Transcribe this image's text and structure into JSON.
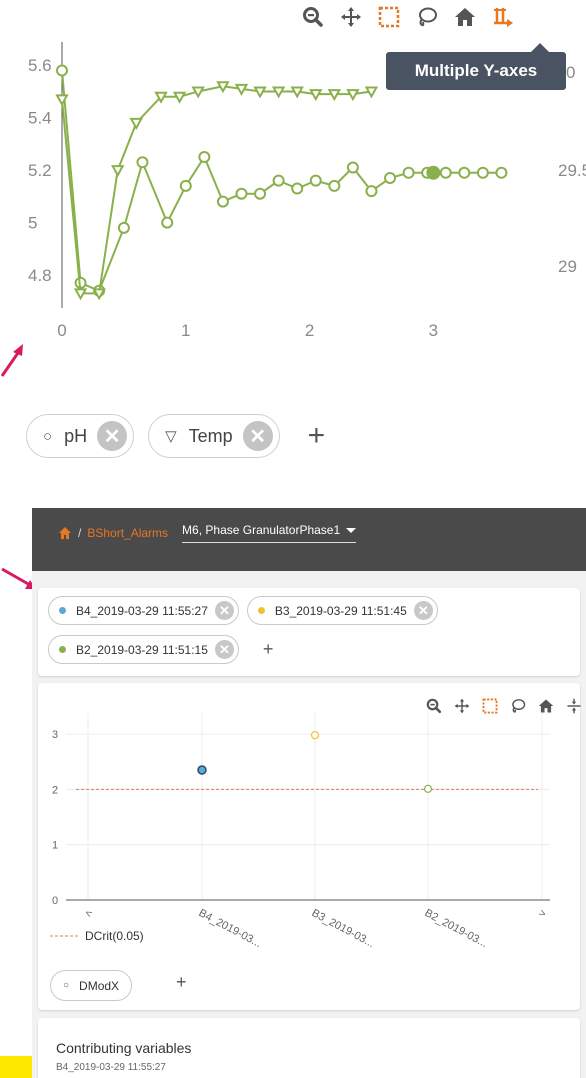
{
  "top_chart": {
    "toolbar_icons": [
      "zoom-icon",
      "pan-icon",
      "box-select-icon",
      "lasso-select-icon",
      "reset-axes-icon",
      "multiple-y-axes-icon"
    ],
    "tooltip": "Multiple Y-axes",
    "left_axis_ticks": [
      "5.6",
      "5.4",
      "5.2",
      "5",
      "4.8"
    ],
    "right_axis_ticks": [
      "0",
      "29.5",
      "29"
    ],
    "x_axis_ticks": [
      "0",
      "1",
      "2",
      "3"
    ],
    "colors": {
      "series": "#8ab04c",
      "tooltip_bg": "#4a5362",
      "active_icon": "#e87722",
      "icon": "#555555",
      "arrow": "#d81b60"
    }
  },
  "chart_data": [
    {
      "type": "line",
      "series": [
        {
          "name": "pH",
          "marker": "circle",
          "x": [
            0,
            0.15,
            0.3,
            0.5,
            0.65,
            0.85,
            1.0,
            1.15,
            1.3,
            1.45,
            1.6,
            1.75,
            1.9,
            2.05,
            2.2,
            2.35,
            2.5,
            2.65,
            2.8,
            2.95,
            3.1,
            3.25,
            3.4,
            3.55
          ],
          "y": [
            5.58,
            4.77,
            4.74,
            4.98,
            5.23,
            5.0,
            5.14,
            5.25,
            5.08,
            5.11,
            5.11,
            5.16,
            5.13,
            5.16,
            5.14,
            5.21,
            5.12,
            5.17,
            5.19,
            5.19,
            5.19,
            5.19,
            5.19,
            5.19
          ]
        },
        {
          "name": "Temp",
          "marker": "triangle-down",
          "x": [
            0,
            0.15,
            0.3,
            0.45,
            0.6,
            0.8,
            0.95,
            1.1,
            1.3,
            1.45,
            1.6,
            1.75,
            1.9,
            2.05,
            2.2,
            2.35,
            2.5
          ],
          "y": [
            5.47,
            4.73,
            4.73,
            5.2,
            5.38,
            5.48,
            5.48,
            5.5,
            5.52,
            5.51,
            5.5,
            5.5,
            5.5,
            5.49,
            5.49,
            5.49,
            5.5
          ]
        }
      ],
      "xlim": [
        0,
        3.7
      ],
      "ylim": [
        4.72,
        5.62
      ],
      "y2_ticks": [
        "29",
        "29.5"
      ],
      "grid": false
    },
    {
      "type": "scatter",
      "categories": [
        "<",
        "B4_2019-03...",
        "B3_2019-03...",
        "B2_2019-03...",
        ">"
      ],
      "series": [
        {
          "name": "DModX",
          "points": [
            {
              "category": "B4_2019-03...",
              "y": 2.35,
              "color": "#5aa9d6"
            },
            {
              "category": "B3_2019-03...",
              "y": 2.98,
              "color": "#f2c12e"
            },
            {
              "category": "B2_2019-03...",
              "y": 2.01,
              "color": "#8ab04c"
            }
          ]
        },
        {
          "name": "DCrit(0.05)",
          "type": "reference-line",
          "y": 2.0,
          "color": "#e07a5f"
        }
      ],
      "ylim": [
        0,
        3.2
      ],
      "y_ticks": [
        "3",
        "2",
        "1",
        "0"
      ],
      "legend": {
        "entry": "DCrit(0.05)",
        "position": "bottom-left"
      },
      "grid": true
    }
  ],
  "top_chips": [
    {
      "symbol": "○",
      "label": "pH",
      "close": "✕"
    },
    {
      "symbol": "▽",
      "label": "Temp",
      "close": "✕"
    }
  ],
  "top_add": "+",
  "dashboard": {
    "breadcrumb": {
      "sep": "/",
      "link": "BShort_Alarms",
      "select": "M6, Phase GranulatorPhase1"
    },
    "filter_chips": [
      {
        "label": "B4_2019-03-29 11:55:27",
        "color": "#5aa9d6",
        "close": "✕"
      },
      {
        "label": "B3_2019-03-29 11:51:45",
        "color": "#f2c12e",
        "close": "✕"
      },
      {
        "label": "B2_2019-03-29 11:51:15",
        "color": "#8ab04c",
        "close": "✕"
      }
    ],
    "filter_add": "+",
    "chart_toolbar_icons": [
      "zoom-icon",
      "pan-icon",
      "box-select-icon",
      "lasso-select-icon",
      "reset-axes-icon",
      "spike-lines-icon"
    ],
    "dmodx_chip": {
      "symbol": "○",
      "label": "DModX"
    },
    "dmodx_add": "+",
    "contributing": {
      "title": "Contributing variables",
      "subtitle": "B4_2019-03-29 11:55:27"
    }
  }
}
